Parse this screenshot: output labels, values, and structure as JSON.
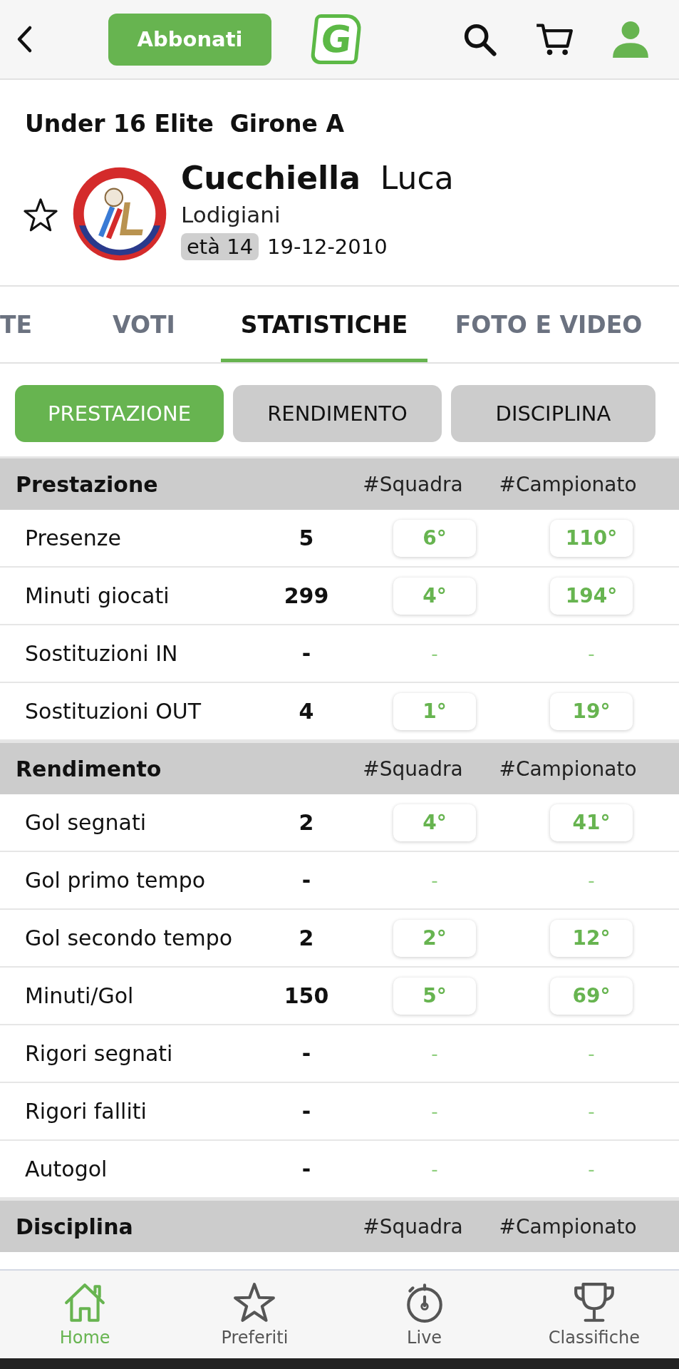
{
  "header": {
    "subscribe_button": "Abbonati",
    "logo_letter": "G"
  },
  "competition": {
    "name": "Under 16 Elite",
    "group": "Girone A"
  },
  "player": {
    "favorite": false,
    "surname": "Cucchiella",
    "name": "Luca",
    "team": "Lodigiani",
    "age": "età 14",
    "birth_date": "19-12-2010"
  },
  "tabs": [
    {
      "label": "TE",
      "selected": false
    },
    {
      "label": "VOTI",
      "selected": false
    },
    {
      "label": "STATISTICHE",
      "selected": true
    },
    {
      "label": "FOTO E VIDEO",
      "selected": false
    }
  ],
  "filters": [
    {
      "label": "PRESTAZIONE",
      "selected": true
    },
    {
      "label": "RENDIMENTO",
      "selected": false
    },
    {
      "label": "DISCIPLINA",
      "selected": false
    }
  ],
  "sections": [
    {
      "title": "Prestazione",
      "col_team": "#Squadra",
      "col_league": "#Campionato",
      "rows": [
        {
          "kind": "ranked",
          "label": "Presenze",
          "value": "5",
          "team_rank": "6°",
          "league_rank": "110°"
        },
        {
          "kind": "ranked",
          "label": "Minuti giocati",
          "value": "299",
          "team_rank": "4°",
          "league_rank": "194°"
        },
        {
          "kind": "empty",
          "label": "Sostituzioni IN",
          "value": "-",
          "team_rank": "-",
          "league_rank": "-"
        },
        {
          "kind": "ranked",
          "label": "Sostituzioni OUT",
          "value": "4",
          "team_rank": "1°",
          "league_rank": "19°"
        }
      ]
    },
    {
      "title": "Rendimento",
      "col_team": "#Squadra",
      "col_league": "#Campionato",
      "rows": [
        {
          "kind": "ranked",
          "label": "Gol segnati",
          "value": "2",
          "team_rank": "4°",
          "league_rank": "41°"
        },
        {
          "kind": "empty",
          "label": "Gol primo tempo",
          "value": "-",
          "team_rank": "-",
          "league_rank": "-"
        },
        {
          "kind": "ranked",
          "label": "Gol secondo tempo",
          "value": "2",
          "team_rank": "2°",
          "league_rank": "12°"
        },
        {
          "kind": "ranked",
          "label": "Minuti/Gol",
          "value": "150",
          "team_rank": "5°",
          "league_rank": "69°"
        },
        {
          "kind": "empty",
          "label": "Rigori segnati",
          "value": "-",
          "team_rank": "-",
          "league_rank": "-"
        },
        {
          "kind": "empty",
          "label": "Rigori falliti",
          "value": "-",
          "team_rank": "-",
          "league_rank": "-"
        },
        {
          "kind": "empty",
          "label": "Autogol",
          "value": "-",
          "team_rank": "-",
          "league_rank": "-"
        }
      ]
    },
    {
      "title": "Disciplina",
      "col_team": "#Squadra",
      "col_league": "#Campionato"
    }
  ],
  "bottom_nav": [
    {
      "label": "Home",
      "kind": "home",
      "selected": true
    },
    {
      "label": "Preferiti",
      "kind": "star",
      "selected": false
    },
    {
      "label": "Live",
      "kind": "stopwatch",
      "selected": false
    },
    {
      "label": "Classifiche",
      "kind": "trophy",
      "selected": false
    }
  ]
}
